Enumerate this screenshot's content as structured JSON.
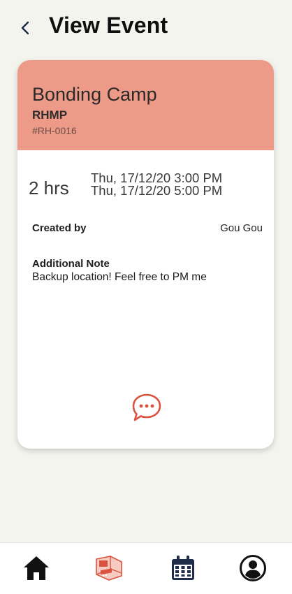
{
  "header": {
    "back_icon": "chevron-left-icon",
    "title": "View Event"
  },
  "event": {
    "title": "Bonding Camp",
    "group": "RHMP",
    "id": "#RH-0016",
    "duration": "2 hrs",
    "start": "Thu, 17/12/20 3:00 PM",
    "end": "Thu, 17/12/20 5:00 PM",
    "created_by_label": "Created by",
    "created_by": "Gou Gou",
    "note_label": "Additional Note",
    "note": "Backup location! Feel free to PM me",
    "chat_icon": "chat-bubble-icon"
  },
  "bottom_nav": {
    "items": [
      {
        "icon": "home-icon"
      },
      {
        "icon": "room-icon"
      },
      {
        "icon": "calendar-icon"
      },
      {
        "icon": "profile-icon"
      }
    ]
  },
  "colors": {
    "background": "#f4f4ef",
    "card_header": "#ee9a88",
    "accent": "#d9533e",
    "nav_dark": "#1f2c4a"
  }
}
